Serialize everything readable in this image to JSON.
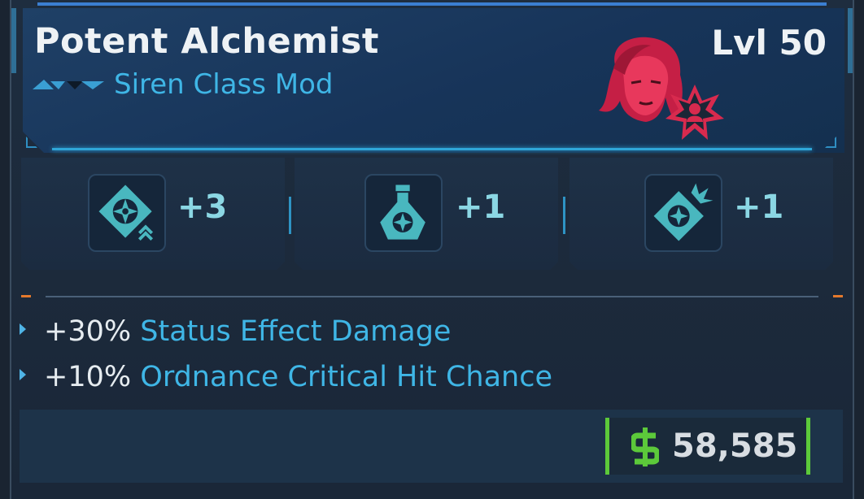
{
  "item": {
    "name": "Potent Alchemist",
    "type": "Siren Class Mod",
    "level": "Lvl 50"
  },
  "colors": {
    "accent": "#3fb6e6",
    "price_border": "#5cc93a",
    "portrait": "#e32952",
    "divider_marker": "#e4792c"
  },
  "skills": [
    {
      "icon": "vortex-skill-icon",
      "value": "+3"
    },
    {
      "icon": "flask-skill-icon",
      "value": "+1"
    },
    {
      "icon": "burst-skill-icon",
      "value": "+1"
    }
  ],
  "stats": [
    {
      "amount": "+30%",
      "name": "Status Effect Damage"
    },
    {
      "amount": "+10%",
      "name": "Ordnance Critical Hit Chance"
    }
  ],
  "price": {
    "value": "58,585",
    "currency_icon": "dollar-icon"
  }
}
